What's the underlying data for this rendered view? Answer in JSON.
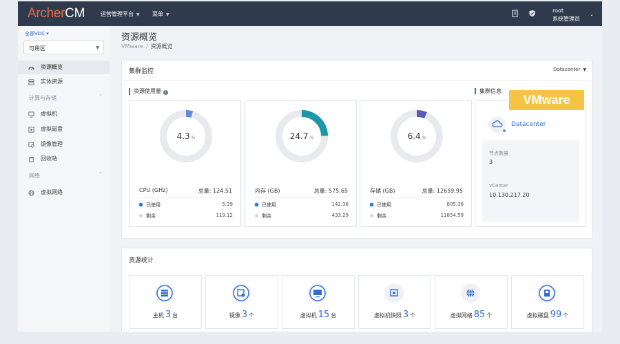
{
  "app": {
    "logo_part1": "Archer",
    "logo_part2": "CM"
  },
  "topbar": {
    "nav": [
      {
        "label": "运营管理平台"
      },
      {
        "label": "菜单"
      }
    ],
    "user": {
      "name": "root",
      "role": "系统管理员"
    }
  },
  "sidebar": {
    "vdc_label": "全部VDC ▾",
    "zone_select": "可用区",
    "items": [
      {
        "label": "资源概览",
        "active": true
      },
      {
        "label": "实体资源"
      }
    ],
    "group_compute": "计算与存储",
    "compute_items": [
      {
        "label": "虚拟机"
      },
      {
        "label": "虚拟磁盘"
      },
      {
        "label": "镜像管理"
      },
      {
        "label": "回收站"
      }
    ],
    "group_network": "网络",
    "network_items": [
      {
        "label": "虚拟网络"
      }
    ]
  },
  "page": {
    "title": "资源概览",
    "breadcrumb": [
      "VMware",
      "/",
      "资源概览"
    ]
  },
  "cluster": {
    "title": "集群监控",
    "dc_select": "Datacenter",
    "usage_label": "资源使用量",
    "info_label": "集群信息",
    "usage": [
      {
        "percent_text": "4.3",
        "percent": 4.3,
        "color": "#5b8ed6",
        "title": "CPU (GHz)",
        "total": "总量: 124.51",
        "used_label": "已使用",
        "used": "5.39",
        "free_label": "剩余",
        "free": "119.12"
      },
      {
        "percent_text": "24.7",
        "percent": 24.7,
        "color": "#1a97a8",
        "title": "内存 (GB)",
        "total": "总量: 575.65",
        "used_label": "已使用",
        "used": "142.36",
        "free_label": "剩余",
        "free": "433.29"
      },
      {
        "percent_text": "6.4",
        "percent": 6.4,
        "color": "#5a5bb8",
        "title": "存储 (GB)",
        "total": "总量: 12659.95",
        "used_label": "已使用",
        "used": "805.36",
        "free_label": "剩余",
        "free": "11854.59"
      }
    ],
    "pct_unit": "%",
    "info": {
      "badge": "VMware",
      "dc_name": "Datacenter",
      "node_count_label": "节点数量",
      "node_count": "3",
      "vcenter_label": "vCenter",
      "vcenter": "10.130.217.20"
    }
  },
  "stats": {
    "title": "资源统计",
    "tiles": [
      {
        "label": "主机",
        "num": "3",
        "unit": "台"
      },
      {
        "label": "镜像",
        "num": "3",
        "unit": "个"
      },
      {
        "label": "虚拟机",
        "num": "15",
        "unit": "台"
      },
      {
        "label": "虚拟机快照",
        "num": "3",
        "unit": "个"
      },
      {
        "label": "虚拟网络",
        "num": "85",
        "unit": "个"
      },
      {
        "label": "虚拟磁盘",
        "num": "99",
        "unit": "个"
      }
    ]
  }
}
